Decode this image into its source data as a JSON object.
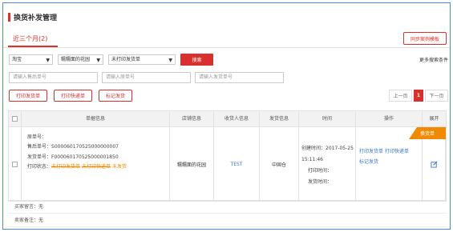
{
  "page": {
    "title": "换货补发管理"
  },
  "tabs": [
    {
      "label": "近三个月(2)"
    }
  ],
  "sync_button": "同步案例模板",
  "filters": {
    "platform": "淘宝",
    "shop": "糯糯面的花园",
    "status": "未打印发货单",
    "search_button": "搜索",
    "more": "更多搜索条件"
  },
  "inputs": {
    "after_sale_placeholder": "请输入售后单号",
    "original_placeholder": "请输入原单号",
    "ship_placeholder": "请输入发货单号"
  },
  "actions": {
    "print_ship": "打印发货单",
    "print_express": "打印快递单",
    "mark_shipped": "标记发货"
  },
  "pagination": {
    "prev": "上一页",
    "current": "1",
    "next": "下一页"
  },
  "table": {
    "headers": [
      "单据信息",
      "店铺信息",
      "收货人信息",
      "发货信息",
      "时间",
      "操作",
      "展开"
    ],
    "row": {
      "badge": "换货单",
      "original_no_label": "原单号：",
      "original_no": "",
      "after_sale_label": "售后单号：",
      "after_sale_no": "S000060170525000000007",
      "ship_label": "发货单号：",
      "ship_no": "F000060170525000001850",
      "print_status_label": "打印状态：",
      "print_tags": [
        "未打印发货单",
        "未打印快递单",
        "未发货"
      ],
      "shop": "糯糯面的花园",
      "receiver": "TEST",
      "ship_info": "中国仓",
      "created_label": "创建时间：",
      "created_time": "2017-05-25 15:11:46",
      "print_time_label": "打印时间：",
      "print_time": "",
      "ship_time_label": "发货时间：",
      "ship_time": "",
      "ops": [
        "打印发货单",
        "打印快递单",
        "标记发货"
      ]
    }
  },
  "notes": [
    {
      "label": "买家留言：",
      "value": "无"
    },
    {
      "label": "卖家备注：",
      "value": "无"
    }
  ]
}
